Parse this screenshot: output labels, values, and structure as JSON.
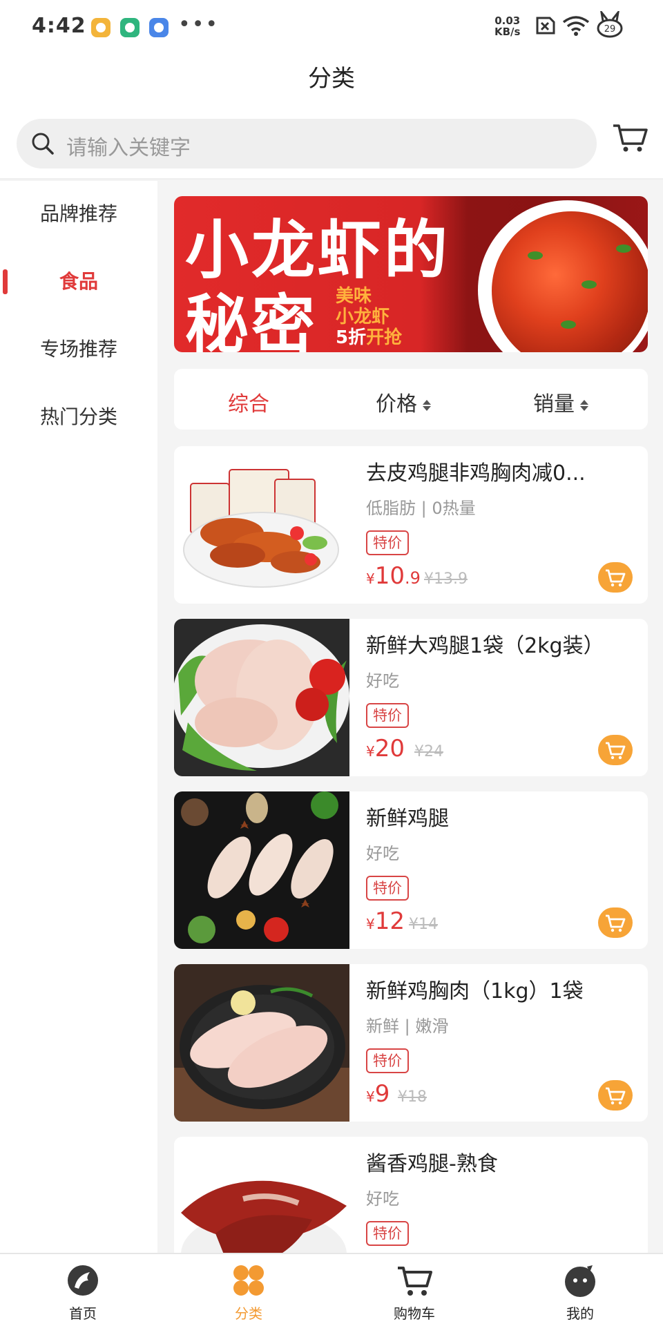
{
  "status_bar": {
    "time": "4:42",
    "more": "•••",
    "net_speed_value": "0.03",
    "net_speed_unit": "KB/s",
    "battery": "29"
  },
  "header": {
    "title": "分类",
    "search_placeholder": "请输入关键字"
  },
  "sidebar": {
    "items": [
      {
        "label": "品牌推荐"
      },
      {
        "label": "食品"
      },
      {
        "label": "专场推荐"
      },
      {
        "label": "热门分类"
      }
    ],
    "active_index": 1
  },
  "banner": {
    "line1": "小龙虾的",
    "line2": "秘密",
    "sub1": "美味",
    "sub2": "小龙虾",
    "sub3_prefix": "5折",
    "sub3_suffix": "开抢"
  },
  "sort_bar": {
    "tabs": [
      {
        "label": "综合"
      },
      {
        "label": "价格"
      },
      {
        "label": "销量"
      }
    ]
  },
  "products": [
    {
      "title": "去皮鸡腿非鸡胸肉减0...",
      "subtitle": "低脂肪 | 0热量",
      "tag": "特价",
      "currency": "¥",
      "price_int": "10",
      "price_dec": ".9",
      "old_price": "¥13.9",
      "image": "roasted-chicken-legs"
    },
    {
      "title": "新鲜大鸡腿1袋（2kg装）",
      "subtitle": "好吃",
      "tag": "特价",
      "currency": "¥",
      "price_int": "20",
      "price_dec": "",
      "old_price": "¥24",
      "image": "raw-chicken-legs"
    },
    {
      "title": "新鲜鸡腿",
      "subtitle": "好吃",
      "tag": "特价",
      "currency": "¥",
      "price_int": "12",
      "price_dec": "",
      "old_price": "¥14",
      "image": "drumsticks-dark"
    },
    {
      "title": "新鲜鸡胸肉（1kg）1袋",
      "subtitle": "新鲜 | 嫩滑",
      "tag": "特价",
      "currency": "¥",
      "price_int": "9",
      "price_dec": "",
      "old_price": "¥18",
      "image": "chicken-breast"
    },
    {
      "title": "酱香鸡腿-熟食",
      "subtitle": "好吃",
      "tag": "特价",
      "currency": "¥",
      "price_int": "",
      "price_dec": "",
      "old_price": "",
      "image": "braised-chicken-legs"
    }
  ],
  "tab_bar": {
    "tabs": [
      {
        "label": "首页",
        "icon": "home-icon"
      },
      {
        "label": "分类",
        "icon": "category-icon"
      },
      {
        "label": "购物车",
        "icon": "cart-icon"
      },
      {
        "label": "我的",
        "icon": "profile-icon"
      }
    ],
    "active_index": 1
  },
  "colors": {
    "accent_red": "#e03a3a",
    "accent_orange": "#f7a437",
    "background": "#f4f4f4"
  }
}
